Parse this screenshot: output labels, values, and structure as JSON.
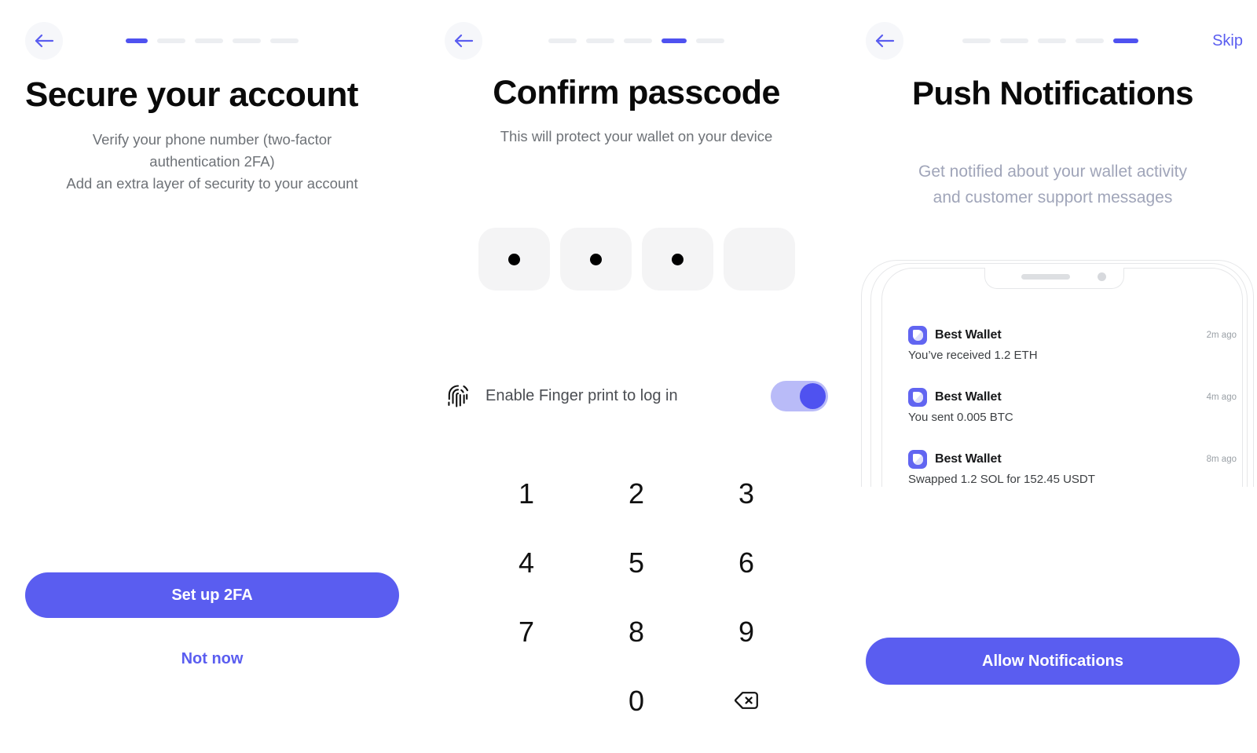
{
  "theme": {
    "accent": "#5a5df0",
    "accent_dark": "#4f52f0",
    "track": "#b9bbf8",
    "inactive_segment": "#eceef1",
    "box_bg": "#f4f4f5",
    "back_btn_bg": "#f6f7fa",
    "muted_text": "#6e7277",
    "light_muted_text": "#a0a5b9"
  },
  "screens": [
    {
      "id": "secure-your-account",
      "back_icon": "arrow-left-icon",
      "progress": {
        "total": 5,
        "active_index": 0
      },
      "title": "Secure your account",
      "subtitle": "Verify your phone number (two-factor authentication 2FA)\nAdd an extra layer of security to your account",
      "subtitle_lines": [
        "Verify your phone number (two-factor",
        "authentication 2FA)",
        "Add an extra layer of security to your account"
      ],
      "primary_button": "Set up 2FA",
      "secondary_link": "Not now"
    },
    {
      "id": "confirm-passcode",
      "back_icon": "arrow-left-icon",
      "progress": {
        "total": 5,
        "active_index": 3
      },
      "title": "Confirm passcode",
      "subtitle": "This will protect your wallet on your device",
      "passcode": {
        "length": 4,
        "filled": 3
      },
      "fingerprint": {
        "icon": "fingerprint-icon",
        "label": "Enable Finger print to log in",
        "toggle_on": true
      },
      "keypad": [
        "1",
        "2",
        "3",
        "4",
        "5",
        "6",
        "7",
        "8",
        "9",
        "",
        "0",
        "backspace-icon"
      ]
    },
    {
      "id": "push-notifications",
      "back_icon": "arrow-left-icon",
      "progress": {
        "total": 5,
        "active_index": 4
      },
      "skip_label": "Skip",
      "title": "Push Notifications",
      "subtitle_lines": [
        "Get notified about your wallet activity",
        "and customer support messages"
      ],
      "phone_mockup": {
        "notch_speaker": "speaker-grille",
        "notch_camera": "front-camera",
        "notifications": [
          {
            "app_icon": "best-wallet-app-icon",
            "app": "Best Wallet",
            "time": "2m ago",
            "body": "You’ve received 1.2 ETH"
          },
          {
            "app_icon": "best-wallet-app-icon",
            "app": "Best Wallet",
            "time": "4m ago",
            "body": "You sent 0.005 BTC"
          },
          {
            "app_icon": "best-wallet-app-icon",
            "app": "Best Wallet",
            "time": "8m ago",
            "body": "Swapped 1.2 SOL for 152.45 USDT"
          }
        ]
      },
      "primary_button": "Allow Notifications"
    }
  ]
}
